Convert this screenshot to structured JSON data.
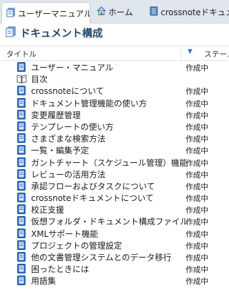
{
  "tabs": [
    {
      "label": "ユーザーマニュアル",
      "icon": "document-icon",
      "active": true
    },
    {
      "label": "ホーム",
      "icon": "home-icon"
    },
    {
      "label": "crossnoteドキュメン",
      "icon": "document-icon"
    }
  ],
  "header": {
    "title": "ドキュメント構成",
    "icon": "document-structure-icon"
  },
  "columns": {
    "title": "タイトル",
    "status": "ステー..."
  },
  "rows": [
    {
      "label": "ユーザー・マニュアル",
      "status": "作成中",
      "icon": "document-icon"
    },
    {
      "label": "目次",
      "status": "",
      "icon": "book-icon"
    },
    {
      "label": "crossnoteについて",
      "status": "作成中",
      "icon": "document-icon"
    },
    {
      "label": "ドキュメント管理機能の使い方",
      "status": "作成中",
      "icon": "document-icon"
    },
    {
      "label": "変更履歴管理",
      "status": "作成中",
      "icon": "document-icon"
    },
    {
      "label": "テンプレートの使い方",
      "status": "作成中",
      "icon": "document-icon"
    },
    {
      "label": "さまざまな検索方法",
      "status": "作成中",
      "icon": "document-icon"
    },
    {
      "label": "一覧・編集予定",
      "status": "作成中",
      "icon": "document-icon"
    },
    {
      "label": "ガントチャート（スケジュール管理）機能",
      "status": "作成中",
      "icon": "document-icon"
    },
    {
      "label": "レビューの活用方法",
      "status": "作成中",
      "icon": "document-icon"
    },
    {
      "label": "承認フローおよびタスクについて",
      "status": "作成中",
      "icon": "document-icon"
    },
    {
      "label": "crossnoteドキュメントについて",
      "status": "作成中",
      "icon": "document-icon"
    },
    {
      "label": "校正支援",
      "status": "作成中",
      "icon": "document-icon"
    },
    {
      "label": "仮想フォルダ・ドキュメント構成ファイル",
      "status": "作成中",
      "icon": "document-icon"
    },
    {
      "label": "XMLサポート機能",
      "status": "作成中",
      "icon": "document-icon"
    },
    {
      "label": "プロジェクトの管理設定",
      "status": "作成中",
      "icon": "document-icon"
    },
    {
      "label": "他の文書管理システムとのデータ移行",
      "status": "作成中",
      "icon": "document-icon"
    },
    {
      "label": "困ったときには",
      "status": "作成中",
      "icon": "document-icon"
    },
    {
      "label": "用語集",
      "status": "作成中",
      "icon": "document-icon"
    }
  ],
  "colors": {
    "accent": "#3b73b9",
    "title": "#26466d",
    "tabbar": "#dfe6ee"
  }
}
